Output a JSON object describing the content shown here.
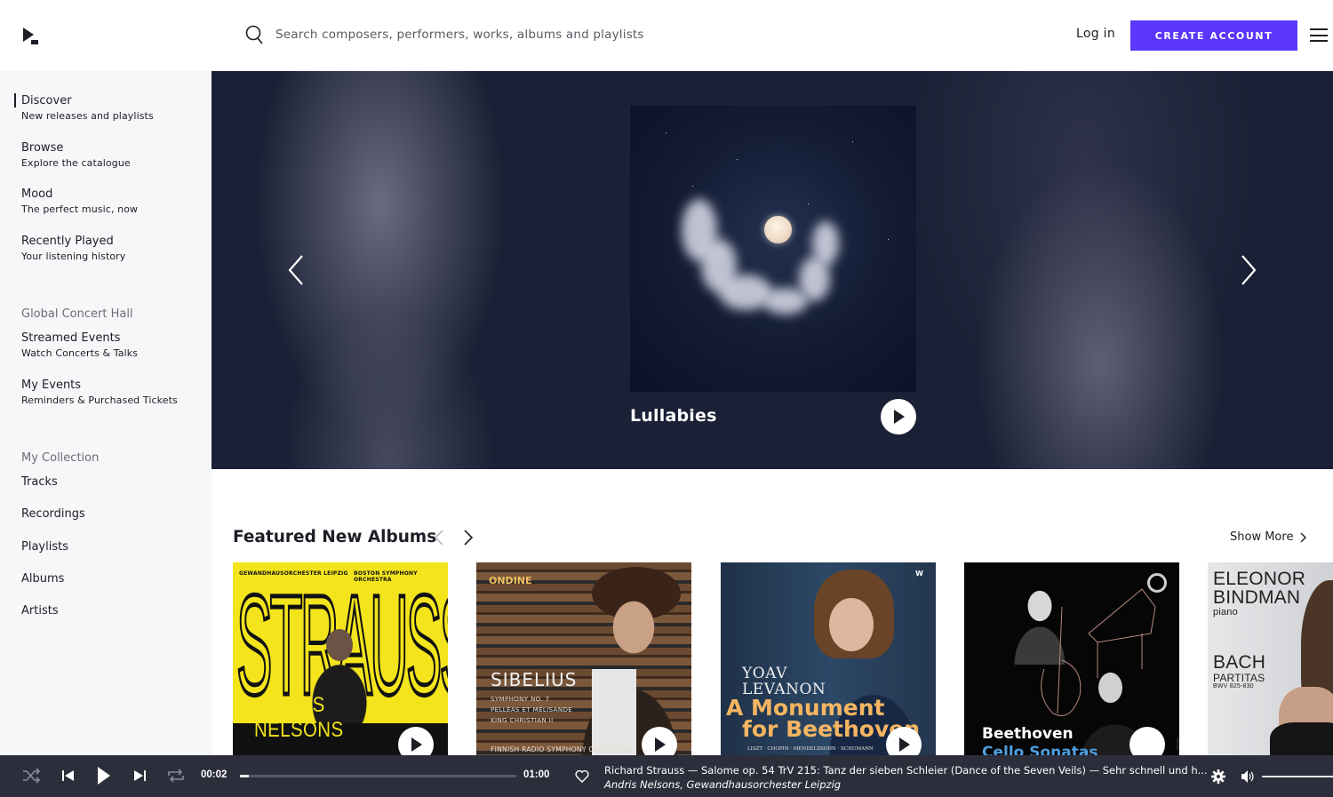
{
  "header": {
    "logo": "play-cursor-logo",
    "search_placeholder": "Search composers, performers, works, albums and playlists",
    "login_label": "Log in",
    "create_account_label": "CREATE ACCOUNT",
    "accent_color": "#5b37fb"
  },
  "sidebar": {
    "main_items": [
      {
        "title": "Discover",
        "subtitle": "New releases and playlists",
        "active": true
      },
      {
        "title": "Browse",
        "subtitle": "Explore the catalogue"
      },
      {
        "title": "Mood",
        "subtitle": "The perfect music, now"
      },
      {
        "title": "Recently Played",
        "subtitle": "Your listening history"
      }
    ],
    "concert_hall": {
      "heading": "Global Concert Hall",
      "items": [
        {
          "title": "Streamed Events",
          "subtitle": "Watch Concerts & Talks"
        },
        {
          "title": "My Events",
          "subtitle": "Reminders & Purchased Tickets"
        }
      ]
    },
    "collection": {
      "heading": "My Collection",
      "items": [
        "Tracks",
        "Recordings",
        "Playlists",
        "Albums",
        "Artists"
      ]
    }
  },
  "hero": {
    "title": "Lullabies"
  },
  "featured": {
    "title": "Featured New Albums",
    "show_more_label": "Show More",
    "albums": [
      {
        "top_left": "GEWANDHAUSORCHESTER LEIPZIG",
        "top_right": "BOSTON SYMPHONY ORCHESTRA",
        "big": "STRAUSS",
        "artist": "ANDRIS NELSONS"
      },
      {
        "label": "ONDINE",
        "title": "SIBELIUS",
        "lines": [
          "SYMPHONY NO. 7",
          "PELLÉAS ET MÉLISANDE",
          "KING CHRISTIAN II"
        ],
        "orchestra": "FINNISH RADIO SYMPHONY ORCHESTRA"
      },
      {
        "label": "W",
        "artist_line1": "YOAV",
        "artist_line2": "LEVANON",
        "title_line1": "A Monument",
        "title_line2": "for Beethoven",
        "composers": "LISZT · CHOPIN · MENDELSSOHN · SCHUMANN"
      },
      {
        "title_line1": "Beethoven",
        "title_line2": "Cello Sonatas"
      },
      {
        "artist_line1": "ELEONOR",
        "artist_line2": "BINDMAN",
        "instrument": "piano",
        "composer": "BACH",
        "work": "PARTITAS",
        "catalogue": "BWV 825-830"
      }
    ]
  },
  "player": {
    "elapsed": "00:02",
    "duration": "01:00",
    "progress_fraction": 0.033,
    "track_title": "Richard Strauss — Salome op. 54 TrV 215: Tanz der sieben Schleier (Dance of the Seven Veils) — Sehr schnell und h...",
    "track_artist": "Andris Nelsons, Gewandhausorchester Leipzig",
    "volume_fraction": 1.0
  }
}
